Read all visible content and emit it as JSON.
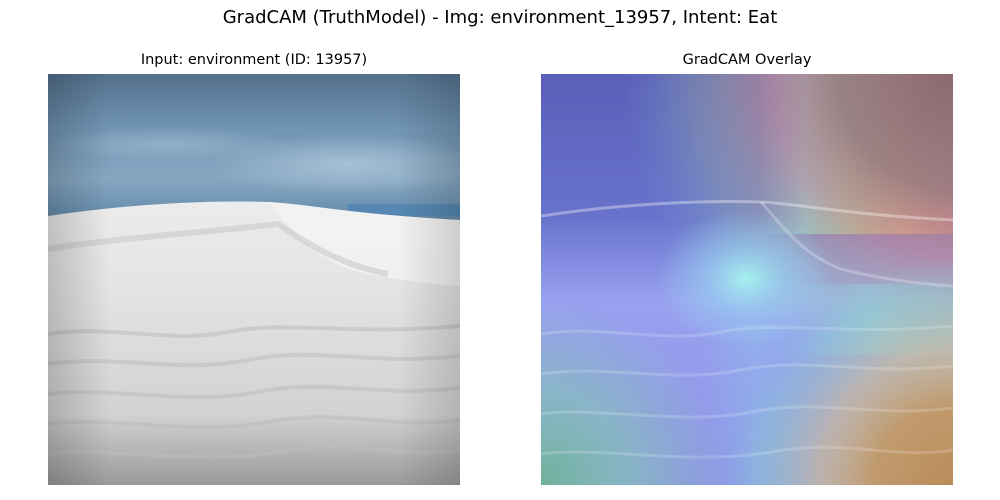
{
  "figure": {
    "title": "GradCAM (TruthModel) - Img: environment_13957, Intent: Eat"
  },
  "panels": [
    {
      "title": "Input: environment (ID: 13957)"
    },
    {
      "title": "GradCAM Overlay"
    }
  ],
  "colors": {
    "background": "#ffffff",
    "sky": "#6b90b1",
    "sand": "#e6e6e6",
    "heatmap_cold": "#4b55c8",
    "heatmap_warm": "#c8a060"
  }
}
